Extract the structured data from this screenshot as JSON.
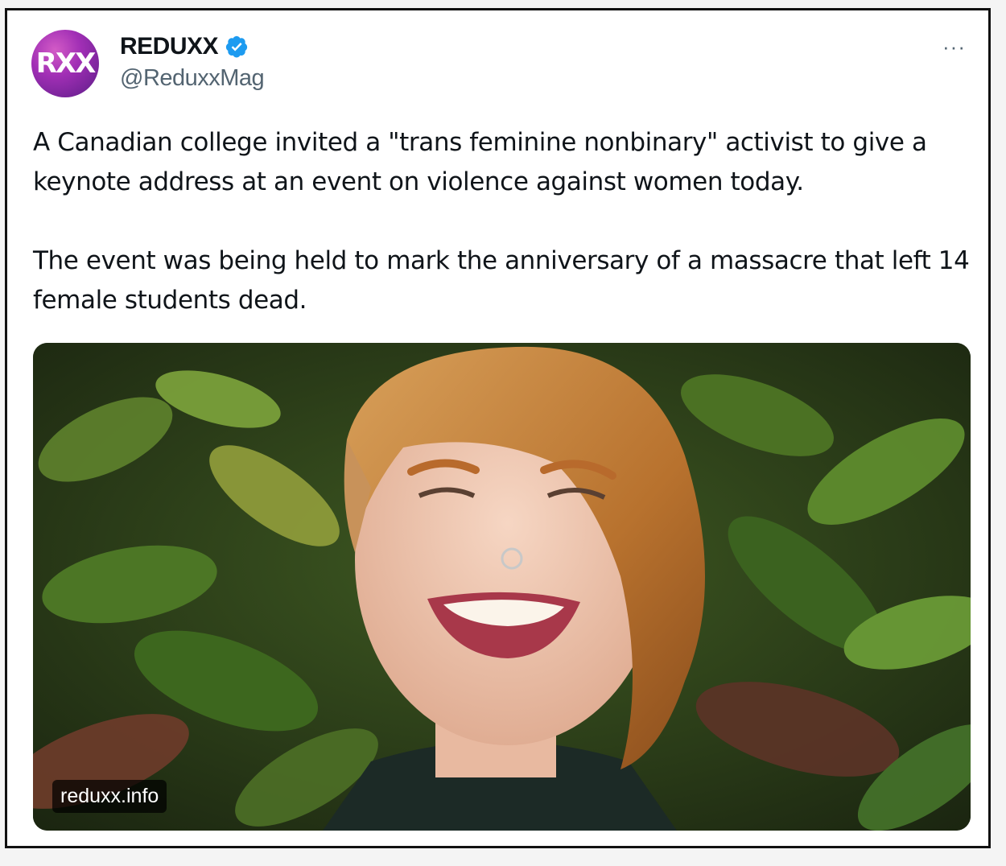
{
  "tweet": {
    "avatar": {
      "initials": "RXX",
      "icon": "reduxx-logo"
    },
    "display_name": "REDUXX",
    "verified_icon": "verified-badge-icon",
    "handle": "@ReduxxMag",
    "more_icon": "more-options-icon",
    "more_glyph": "···",
    "text_paragraphs": [
      "A Canadian college invited a \"trans feminine nonbinary\" activist to give a keynote address at an event on violence against women today.",
      "The event was being held to mark the anniversary of a massacre that left 14 female students dead."
    ],
    "media": {
      "link_label": "reduxx.info"
    }
  },
  "colors": {
    "text": "#0f1419",
    "secondary": "#536471",
    "verified": "#1d9bf0"
  }
}
